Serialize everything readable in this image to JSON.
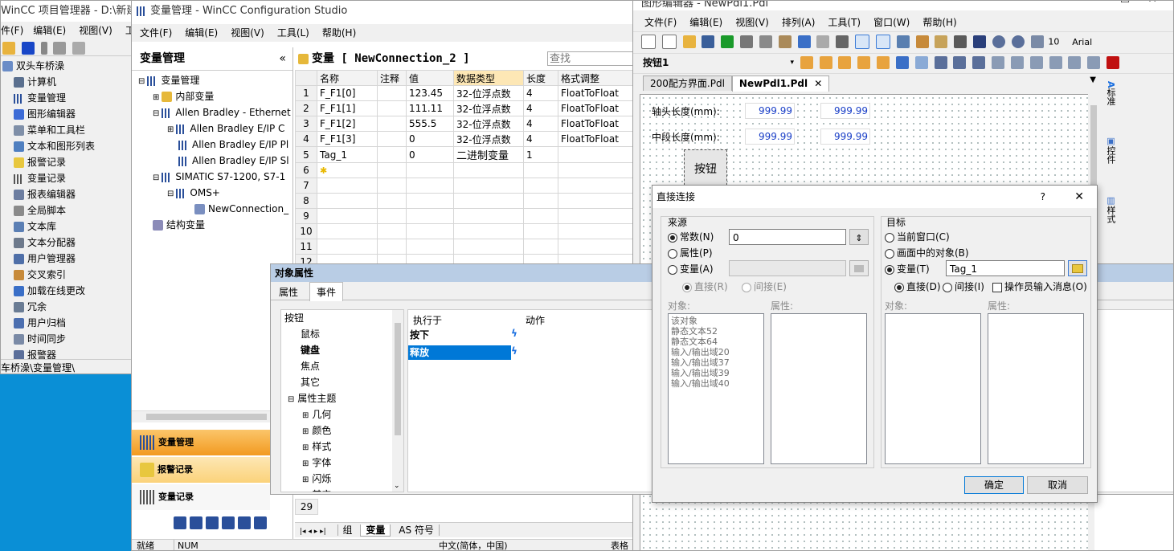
{
  "left_window": {
    "title": "WinCC 项目管理器 - D:\\新建文",
    "menu": [
      "件(F)",
      "编辑(E)",
      "视图(V)",
      "工"
    ],
    "tree": [
      "双头车桥澡",
      "计算机",
      "变量管理",
      "图形编辑器",
      "菜单和工具栏",
      "文本和图形列表",
      "报警记录",
      "变量记录",
      "报表编辑器",
      "全局脚本",
      "文本库",
      "文本分配器",
      "用户管理器",
      "交叉索引",
      "加载在线更改",
      "冗余",
      "用户归档",
      "时间同步",
      "报警器"
    ],
    "status": "车桥澡\\变量管理\\"
  },
  "config_studio": {
    "title": "变量管理 - WinCC Configuration Studio",
    "menu": [
      "文件(F)",
      "编辑(E)",
      "视图(V)",
      "工具(L)",
      "帮助(H)"
    ],
    "nav_title": "变量管理",
    "nav_collapse": "«",
    "tree": [
      {
        "label": "变量管理",
        "indent": 0
      },
      {
        "label": "内部变量",
        "indent": 1
      },
      {
        "label": "Allen Bradley - Ethernet",
        "indent": 1
      },
      {
        "label": "Allen Bradley E/IP C",
        "indent": 2
      },
      {
        "label": "Allen Bradley E/IP Pl",
        "indent": 2
      },
      {
        "label": "Allen Bradley E/IP Sl",
        "indent": 2
      },
      {
        "label": "SIMATIC S7-1200, S7-1",
        "indent": 1
      },
      {
        "label": "OMS+",
        "indent": 2
      },
      {
        "label": "NewConnection_",
        "indent": 3
      },
      {
        "label": "结构变量",
        "indent": 0
      }
    ],
    "nav_buttons": [
      "变量管理",
      "报警记录",
      "变量记录"
    ],
    "grid_title": "变量 [ NewConnection_2 ]",
    "search_placeholder": "查找",
    "columns": [
      "名称",
      "注释",
      "值",
      "数据类型",
      "长度",
      "格式调整"
    ],
    "rows": [
      {
        "n": "1",
        "name": "F_F1[0]",
        "comment": "",
        "value": "123.45",
        "type": "32-位浮点数",
        "len": "4",
        "fmt": "FloatToFloat"
      },
      {
        "n": "2",
        "name": "F_F1[1]",
        "comment": "",
        "value": "111.11",
        "type": "32-位浮点数",
        "len": "4",
        "fmt": "FloatToFloat"
      },
      {
        "n": "3",
        "name": "F_F1[2]",
        "comment": "",
        "value": "555.5",
        "type": "32-位浮点数",
        "len": "4",
        "fmt": "FloatToFloat"
      },
      {
        "n": "4",
        "name": "F_F1[3]",
        "comment": "",
        "value": "0",
        "type": "32-位浮点数",
        "len": "4",
        "fmt": "FloatToFloat"
      },
      {
        "n": "5",
        "name": "Tag_1",
        "comment": "",
        "value": "0",
        "type": "二进制变量",
        "len": "1",
        "fmt": ""
      },
      {
        "n": "6",
        "name": "",
        "comment": "",
        "value": "",
        "type": "",
        "len": "",
        "fmt": ""
      },
      {
        "n": "7",
        "name": "",
        "comment": "",
        "value": "",
        "type": "",
        "len": "",
        "fmt": ""
      },
      {
        "n": "8",
        "name": "",
        "comment": "",
        "value": "",
        "type": "",
        "len": "",
        "fmt": ""
      },
      {
        "n": "9",
        "name": "",
        "comment": "",
        "value": "",
        "type": "",
        "len": "",
        "fmt": ""
      },
      {
        "n": "10",
        "name": "",
        "comment": "",
        "value": "",
        "type": "",
        "len": "",
        "fmt": ""
      },
      {
        "n": "11",
        "name": "",
        "comment": "",
        "value": "",
        "type": "",
        "len": "",
        "fmt": ""
      },
      {
        "n": "12",
        "name": "",
        "comment": "",
        "value": "",
        "type": "",
        "len": "",
        "fmt": ""
      }
    ],
    "row_29": "29",
    "bottom_tabs": [
      "组",
      "变量",
      "AS 符号"
    ],
    "status": [
      "就绪",
      "NUM",
      "中文(简体，中国)",
      "表格"
    ]
  },
  "object_props": {
    "title": "对象属性",
    "tabs": [
      "属性",
      "事件"
    ],
    "tree_root": "按钮",
    "tree": [
      {
        "label": "鼠标",
        "bold": false
      },
      {
        "label": "键盘",
        "bold": true
      },
      {
        "label": "焦点",
        "bold": false
      },
      {
        "label": "其它",
        "bold": false
      },
      {
        "label": "属性主题",
        "bold": false
      },
      {
        "label": "几何",
        "bold": false
      },
      {
        "label": "颜色",
        "bold": false
      },
      {
        "label": "样式",
        "bold": false
      },
      {
        "label": "字体",
        "bold": false
      },
      {
        "label": "闪烁",
        "bold": false
      },
      {
        "label": "其它",
        "bold": false
      }
    ],
    "col_exec": "执行于",
    "col_action": "动作",
    "events": [
      {
        "label": "按下",
        "selected": false
      },
      {
        "label": "释放",
        "selected": true
      }
    ]
  },
  "graphics_designer": {
    "title": "图形编辑器 - NewPdl1.Pdl",
    "menu": [
      "文件(F)",
      "编辑(E)",
      "视图(V)",
      "排列(A)",
      "工具(T)",
      "窗口(W)",
      "帮助(H)"
    ],
    "zoom": "10",
    "font": "Arial",
    "object_combo": "按钮1",
    "tabs": [
      "200配方界面.Pdl",
      "NewPdl1.Pdl"
    ],
    "tab_close": "✕",
    "labels": [
      "轴头长度(mm):",
      "中段长度(mm):"
    ],
    "fields": [
      "999.99",
      "999.99",
      "999.99",
      "999.99"
    ],
    "button_label": "按钮",
    "side_tabs": [
      "标准",
      "控件",
      "样式"
    ]
  },
  "dialog": {
    "title": "直接连接",
    "help": "?",
    "close": "✕",
    "source_title": "来源",
    "source_options": [
      {
        "label": "常数(N)",
        "checked": true
      },
      {
        "label": "属性(P)",
        "checked": false
      },
      {
        "label": "变量(A)",
        "checked": false
      }
    ],
    "source_constant": "0",
    "source_sub": [
      "直接(R)",
      "间接(E)"
    ],
    "source_object_label": "对象:",
    "source_property_label": "属性:",
    "source_objects": [
      "该对象",
      "静态文本52",
      "静态文本64",
      "输入/输出域20",
      "输入/输出域37",
      "输入/输出域39",
      "输入/输出域40"
    ],
    "target_title": "目标",
    "target_options": [
      {
        "label": "当前窗口(C)",
        "checked": false
      },
      {
        "label": "画面中的对象(B)",
        "checked": false
      },
      {
        "label": "变量(T)",
        "checked": true
      }
    ],
    "target_tag": "Tag_1",
    "target_sub": [
      {
        "label": "直接(D)",
        "checked": true
      },
      {
        "label": "间接(I)",
        "checked": false
      }
    ],
    "operator_msg": "操作员输入消息(O)",
    "target_object_label": "对象:",
    "target_property_label": "属性:",
    "ok": "确定",
    "cancel": "取消"
  },
  "colors": {
    "desktop": "#0a8fd6",
    "selection": "#0078d7",
    "nav_active": "#f7a83a",
    "grid_header": "#fde7b5"
  }
}
